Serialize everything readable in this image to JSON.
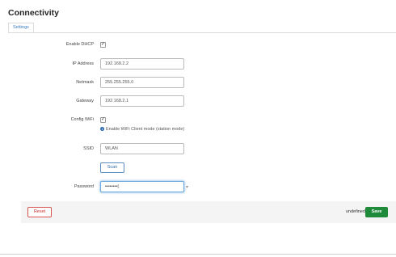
{
  "page": {
    "title": "Connectivity"
  },
  "tabs": [
    {
      "label": "Settings"
    }
  ],
  "form": {
    "dhcp": {
      "label": "Enable DHCP",
      "checked_mark": "✓"
    },
    "ip": {
      "label": "IP Address",
      "value": "192.168.2.2"
    },
    "netmask": {
      "label": "Netmask",
      "value": "255.255.255.0"
    },
    "gateway": {
      "label": "Gateway",
      "value": "192.168.2.1"
    },
    "wifi": {
      "label": "Config WiFi",
      "checked_mark": "✓",
      "help": "Enable WiFi Client mode (station mode)"
    },
    "ssid": {
      "label": "SSID",
      "value": "WLAN"
    },
    "scan": {
      "label": "Scan"
    },
    "password": {
      "label": "Password",
      "value": "••••••••|",
      "reveal_icon": "eye-icon"
    }
  },
  "footer": {
    "reset_label": "Reset",
    "status_text": "undefined",
    "save_label": "Save"
  },
  "colors": {
    "accent": "#3a7fc4",
    "save": "#1f8a3a",
    "reset": "#d9534f",
    "focus_border": "#6ea8dc"
  }
}
